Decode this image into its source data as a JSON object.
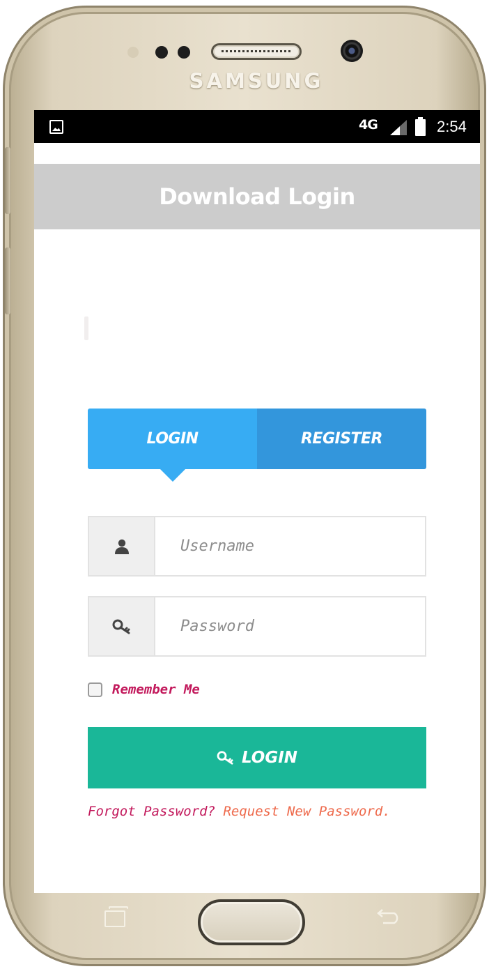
{
  "device": {
    "brand": "SAMSUNG"
  },
  "status_bar": {
    "network": "4G",
    "time": "2:54"
  },
  "header": {
    "title": "Download Login"
  },
  "tabs": [
    {
      "label": "LOGIN",
      "active": true
    },
    {
      "label": "REGISTER",
      "active": false
    }
  ],
  "form": {
    "username": {
      "placeholder": "Username",
      "value": "",
      "icon": "user-icon"
    },
    "password": {
      "placeholder": "Password",
      "value": "",
      "icon": "key-icon"
    },
    "remember": {
      "label": "Remember Me",
      "checked": false
    },
    "submit": {
      "label": "LOGIN",
      "icon": "key-icon"
    },
    "forgot": {
      "question": "Forgot Password?",
      "link": "Request New Password."
    }
  },
  "colors": {
    "tab_login": "#37acf3",
    "tab_register": "#3396dc",
    "login_button": "#1ab798",
    "header_bg": "#cccccc",
    "accent_text": "#c2185b",
    "link_text": "#ee6a4c"
  }
}
